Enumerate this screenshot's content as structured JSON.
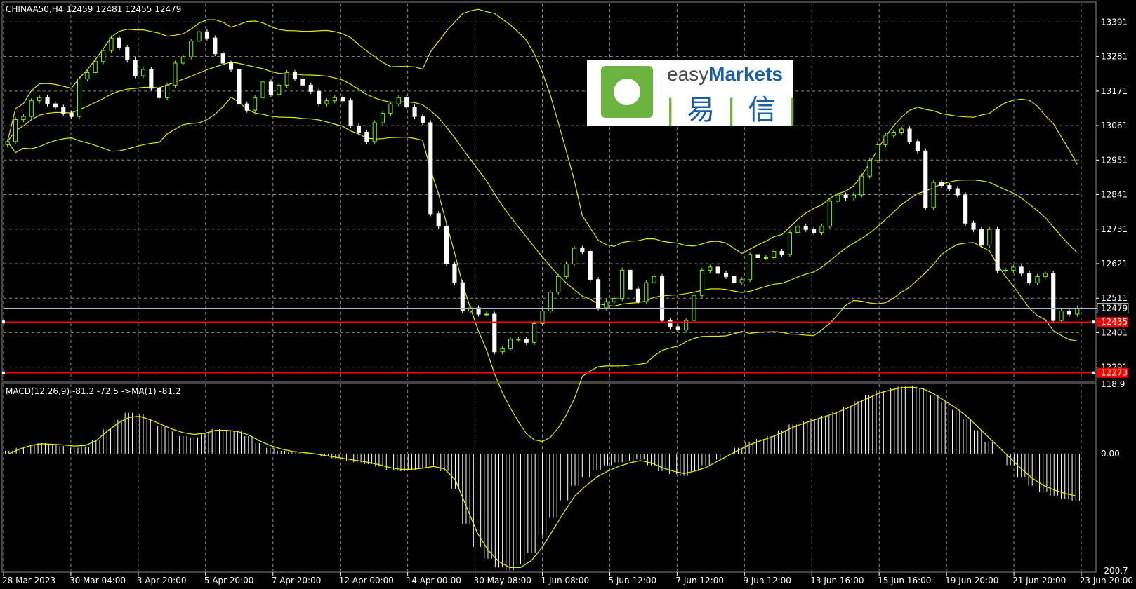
{
  "header": {
    "symbol_info": "CHINAA50,H4  12459 12481 12455 12479",
    "indicator_info": "MACD(12,26,9) -81.2 -72.5  ->MA(1) -81.2"
  },
  "logo": {
    "brand_prefix": "easy",
    "brand_suffix": "Markets",
    "cn_left": "易",
    "cn_right": "信",
    "separator": "|"
  },
  "colors": {
    "background": "#000000",
    "grid": "#8a8a8a",
    "bull_candle": "#7cfc00",
    "bear_candle": "#ffffff",
    "bollinger": "#e8e800",
    "support_line": "#ff0000",
    "price_line": "#a0b8c8",
    "macd_hist": "#ffffff",
    "signal": "#e8e800"
  },
  "chart_data": [
    {
      "type": "candlestick",
      "title": "CHINAA50,H4",
      "ylim": [
        12250,
        13450
      ],
      "y_ticks": [
        "13391",
        "13281",
        "13171",
        "13061",
        "12951",
        "12841",
        "12731",
        "12621",
        "12511",
        "12401",
        "12291"
      ],
      "current_price_label": "12479",
      "horizontal_levels": [
        "12435",
        "12273"
      ],
      "x_labels": [
        "28 Mar 2023",
        "30 Mar 04:00",
        "3 Apr 20:00",
        "5 Apr 20:00",
        "7 Apr 20:00",
        "12 Apr 00:00",
        "14 Apr 00:00",
        "30 May 08:00",
        "1 Jun 08:00",
        "5 Jun 12:00",
        "7 Jun 12:00",
        "9 Jun 12:00",
        "13 Jun 16:00",
        "15 Jun 16:00",
        "19 Jun 20:00",
        "21 Jun 20:00",
        "23 Jun 20:00"
      ],
      "closes": [
        13010,
        13080,
        13090,
        13140,
        13150,
        13130,
        13120,
        13100,
        13090,
        13210,
        13230,
        13265,
        13300,
        13340,
        13310,
        13270,
        13220,
        13240,
        13180,
        13150,
        13190,
        13260,
        13280,
        13330,
        13360,
        13340,
        13290,
        13260,
        13240,
        13130,
        13110,
        13150,
        13200,
        13160,
        13190,
        13230,
        13210,
        13190,
        13170,
        13130,
        13140,
        13150,
        13140,
        13060,
        13040,
        13010,
        13070,
        13100,
        13130,
        13150,
        13120,
        13090,
        13070,
        12780,
        12740,
        12620,
        12560,
        12470,
        12480,
        12460,
        12460,
        12340,
        12350,
        12380,
        12380,
        12370,
        12430,
        12470,
        12530,
        12580,
        12620,
        12670,
        12660,
        12570,
        12480,
        12500,
        12510,
        12600,
        12540,
        12500,
        12560,
        12580,
        12440,
        12420,
        12410,
        12440,
        12520,
        12600,
        12610,
        12590,
        12580,
        12560,
        12570,
        12650,
        12640,
        12640,
        12660,
        12650,
        12720,
        12740,
        12730,
        12720,
        12740,
        12820,
        12840,
        12830,
        12840,
        12900,
        12950,
        13000,
        13030,
        13040,
        13050,
        13010,
        12980,
        12800,
        12880,
        12870,
        12860,
        12840,
        12750,
        12730,
        12680,
        12730,
        12600,
        12600,
        12610,
        12590,
        12560,
        12580,
        12590,
        12440,
        12470,
        12460,
        12479
      ],
      "macd": {
        "ylim": [
          -200.7,
          118.9
        ],
        "y_ticks": [
          "118.9",
          "0.00",
          "-200.7"
        ],
        "histogram": [
          5,
          10,
          15,
          18,
          15,
          13,
          10,
          12,
          24,
          42,
          58,
          70,
          68,
          58,
          48,
          38,
          30,
          28,
          35,
          42,
          40,
          38,
          30,
          18,
          10,
          5,
          2,
          1,
          0,
          -5,
          -8,
          -12,
          -15,
          -18,
          -22,
          -28,
          -30,
          -28,
          -25,
          -20,
          -30,
          -60,
          -120,
          -160,
          -180,
          -195,
          -200,
          -190,
          -170,
          -140,
          -110,
          -80,
          -55,
          -40,
          -28,
          -20,
          -15,
          -12,
          -10,
          -20,
          -30,
          -35,
          -38,
          -30,
          -20,
          -10,
          0,
          10,
          20,
          25,
          30,
          40,
          50,
          55,
          60,
          65,
          72,
          80,
          90,
          100,
          108,
          112,
          115,
          116,
          112,
          100,
          88,
          75,
          60,
          40,
          20,
          0,
          -20,
          -40,
          -55,
          -65,
          -72,
          -78,
          -81
        ],
        "signal": [
          0,
          8,
          14,
          17,
          16,
          15,
          13,
          14,
          22,
          38,
          52,
          62,
          64,
          58,
          50,
          42,
          36,
          33,
          35,
          40,
          40,
          38,
          32,
          22,
          14,
          8,
          4,
          2,
          0,
          -3,
          -6,
          -9,
          -12,
          -15,
          -19,
          -24,
          -27,
          -27,
          -25,
          -22,
          -26,
          -45,
          -90,
          -135,
          -165,
          -185,
          -195,
          -195,
          -183,
          -160,
          -130,
          -100,
          -72,
          -55,
          -40,
          -30,
          -22,
          -16,
          -12,
          -16,
          -24,
          -30,
          -34,
          -30,
          -24,
          -14,
          -4,
          6,
          15,
          22,
          28,
          36,
          45,
          52,
          58,
          64,
          70,
          78,
          87,
          96,
          104,
          109,
          113,
          114,
          111,
          102,
          90,
          78,
          64,
          46,
          28,
          10,
          -8,
          -26,
          -42,
          -54,
          -62,
          -68,
          -72.5
        ]
      }
    }
  ]
}
